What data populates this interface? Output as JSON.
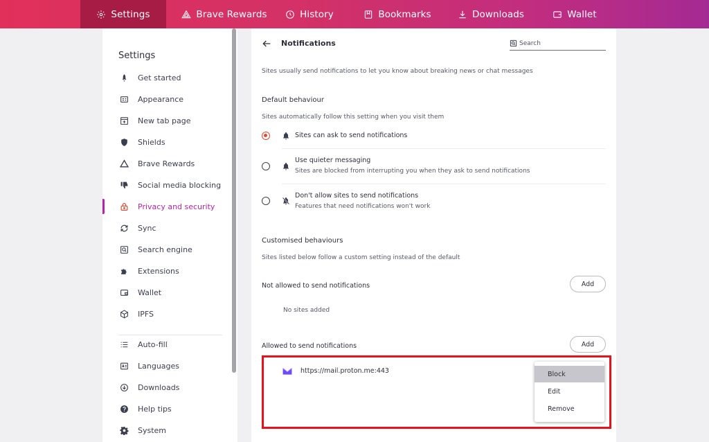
{
  "nav": {
    "tabs": [
      {
        "label": "Settings",
        "icon": "gear-icon",
        "active": true
      },
      {
        "label": "Brave Rewards",
        "icon": "triangle-icon",
        "active": false
      },
      {
        "label": "History",
        "icon": "history-icon",
        "active": false
      },
      {
        "label": "Bookmarks",
        "icon": "bookmark-icon",
        "active": false
      },
      {
        "label": "Downloads",
        "icon": "download-icon",
        "active": false
      },
      {
        "label": "Wallet",
        "icon": "wallet-icon",
        "active": false
      }
    ]
  },
  "sidebar": {
    "title": "Settings",
    "items": [
      {
        "label": "Get started",
        "icon": "rocket-icon"
      },
      {
        "label": "Appearance",
        "icon": "appearance-icon"
      },
      {
        "label": "New tab page",
        "icon": "new-tab-icon"
      },
      {
        "label": "Shields",
        "icon": "shield-icon"
      },
      {
        "label": "Brave Rewards",
        "icon": "triangle-icon"
      },
      {
        "label": "Social media blocking",
        "icon": "thumbs-down-icon"
      },
      {
        "label": "Privacy and security",
        "icon": "lock-icon",
        "active": true
      },
      {
        "label": "Sync",
        "icon": "sync-icon"
      },
      {
        "label": "Search engine",
        "icon": "search-icon"
      },
      {
        "label": "Extensions",
        "icon": "puzzle-icon"
      },
      {
        "label": "Wallet",
        "icon": "wallet-icon"
      },
      {
        "label": "IPFS",
        "icon": "cube-icon"
      },
      {
        "label": "Auto-fill",
        "icon": "list-icon"
      },
      {
        "label": "Languages",
        "icon": "language-icon"
      },
      {
        "label": "Downloads",
        "icon": "download-icon"
      },
      {
        "label": "Help tips",
        "icon": "help-icon"
      },
      {
        "label": "System",
        "icon": "gear-icon"
      }
    ]
  },
  "main": {
    "page_title": "Notifications",
    "search_placeholder": "Search",
    "intro": "Sites usually send notifications to let you know about breaking news or chat messages",
    "default_behaviour": {
      "heading": "Default behaviour",
      "description": "Sites automatically follow this setting when you visit them",
      "options": [
        {
          "title": "Sites can ask to send notifications",
          "subtitle": "",
          "selected": true
        },
        {
          "title": "Use quieter messaging",
          "subtitle": "Sites are blocked from interrupting you when they ask to send notifications",
          "selected": false
        },
        {
          "title": "Don't allow sites to send notifications",
          "subtitle": "Features that need notifications won't work",
          "selected": false
        }
      ]
    },
    "customised": {
      "heading": "Customised behaviours",
      "description": "Sites listed below follow a custom setting instead of the default",
      "not_allowed": {
        "label": "Not allowed to send notifications",
        "add_label": "Add",
        "empty_text": "No sites added"
      },
      "allowed": {
        "label": "Allowed to send notifications",
        "add_label": "Add",
        "sites": [
          {
            "url": "https://mail.proton.me:443",
            "icon": "proton-mail-icon"
          }
        ]
      }
    },
    "context_menu": {
      "items": [
        "Block",
        "Edit",
        "Remove"
      ],
      "highlighted": "Block"
    }
  },
  "colors": {
    "accent": "#b524a8",
    "radio_selected": "#e04a2f",
    "highlight_border": "#e8121c"
  }
}
